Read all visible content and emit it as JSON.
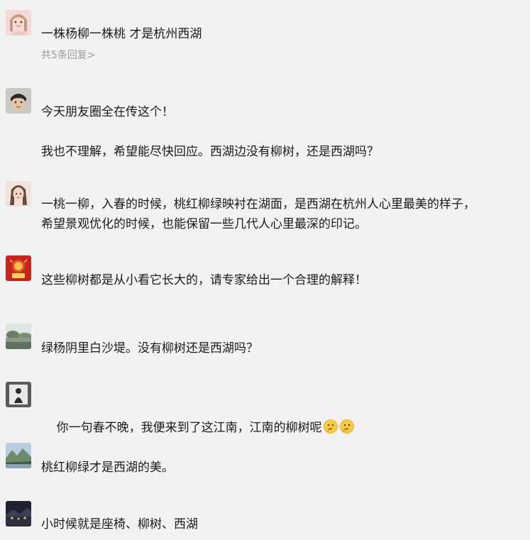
{
  "comments": [
    {
      "text": "一株杨柳一株桃 才是杭州西湖",
      "replies": "共5条回复>"
    },
    {
      "text": "今天朋友圈全在传这个！\n\n我也不理解，希望能尽快回应。西湖边没有柳树，还是西湖吗？"
    },
    {
      "text": "一桃一柳，入春的时候，桃红柳绿映衬在湖面，是西湖在杭州人心里最美的样子，\n希望景观优化的时候，也能保留一些几代人心里最深的印记。"
    },
    {
      "text": "这些柳树都是从小看它长大的，请专家给出一个合理的解释！"
    },
    {
      "text": "绿杨阴里白沙堤。没有柳树还是西湖吗？"
    },
    {
      "text": "你一句春不晚，我便来到了这江南，江南的柳树呢"
    },
    {
      "text": "桃红柳绿才是西湖的美。"
    },
    {
      "text": "小时候就是座椅、柳树、西湖"
    }
  ]
}
